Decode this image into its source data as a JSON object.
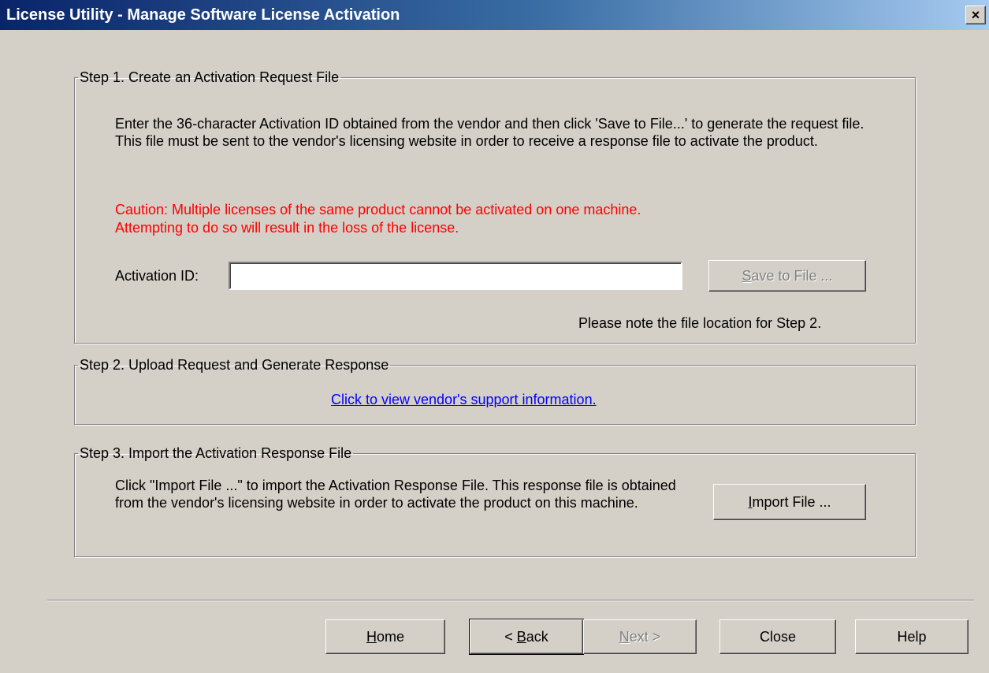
{
  "window": {
    "title": "License Utility - Manage Software License Activation",
    "close_glyph": "×"
  },
  "step1": {
    "legend": "Step 1. Create an Activation Request File",
    "description": "Enter the 36-character Activation ID obtained from the vendor and then click 'Save to File...' to generate the request file. This file must be sent to the vendor's licensing website in order to receive a response file to activate the product.",
    "caution_line1": "Caution: Multiple licenses of the same product cannot be activated on one machine.",
    "caution_line2": "Attempting to do so will result in the loss of the license.",
    "activation_label": "Activation ID:",
    "activation_value": "",
    "save_button": {
      "mnemonic": "S",
      "rest": "ave to File ...",
      "enabled": false
    },
    "note": "Please note the file location for Step 2."
  },
  "step2": {
    "legend": "Step 2. Upload Request and Generate Response",
    "link_text": "Click to view vendor's support information."
  },
  "step3": {
    "legend": "Step 3. Import the Activation Response File",
    "description": "Click \"Import File ...\" to import the Activation Response File.  This response file is obtained from the vendor's licensing website in order to activate the product on this machine.",
    "import_button": {
      "mnemonic": "I",
      "rest": "mport File ..."
    }
  },
  "footer": {
    "home": {
      "mnemonic": "H",
      "rest": "ome"
    },
    "back": {
      "prefix": "< ",
      "mnemonic": "B",
      "rest": "ack"
    },
    "next": {
      "mnemonic": "N",
      "rest": "ext >",
      "enabled": false
    },
    "close": "Close",
    "help": "Help"
  },
  "colors": {
    "caution": "#ff0000",
    "link": "#0000ff",
    "face": "#d4d0c8"
  }
}
